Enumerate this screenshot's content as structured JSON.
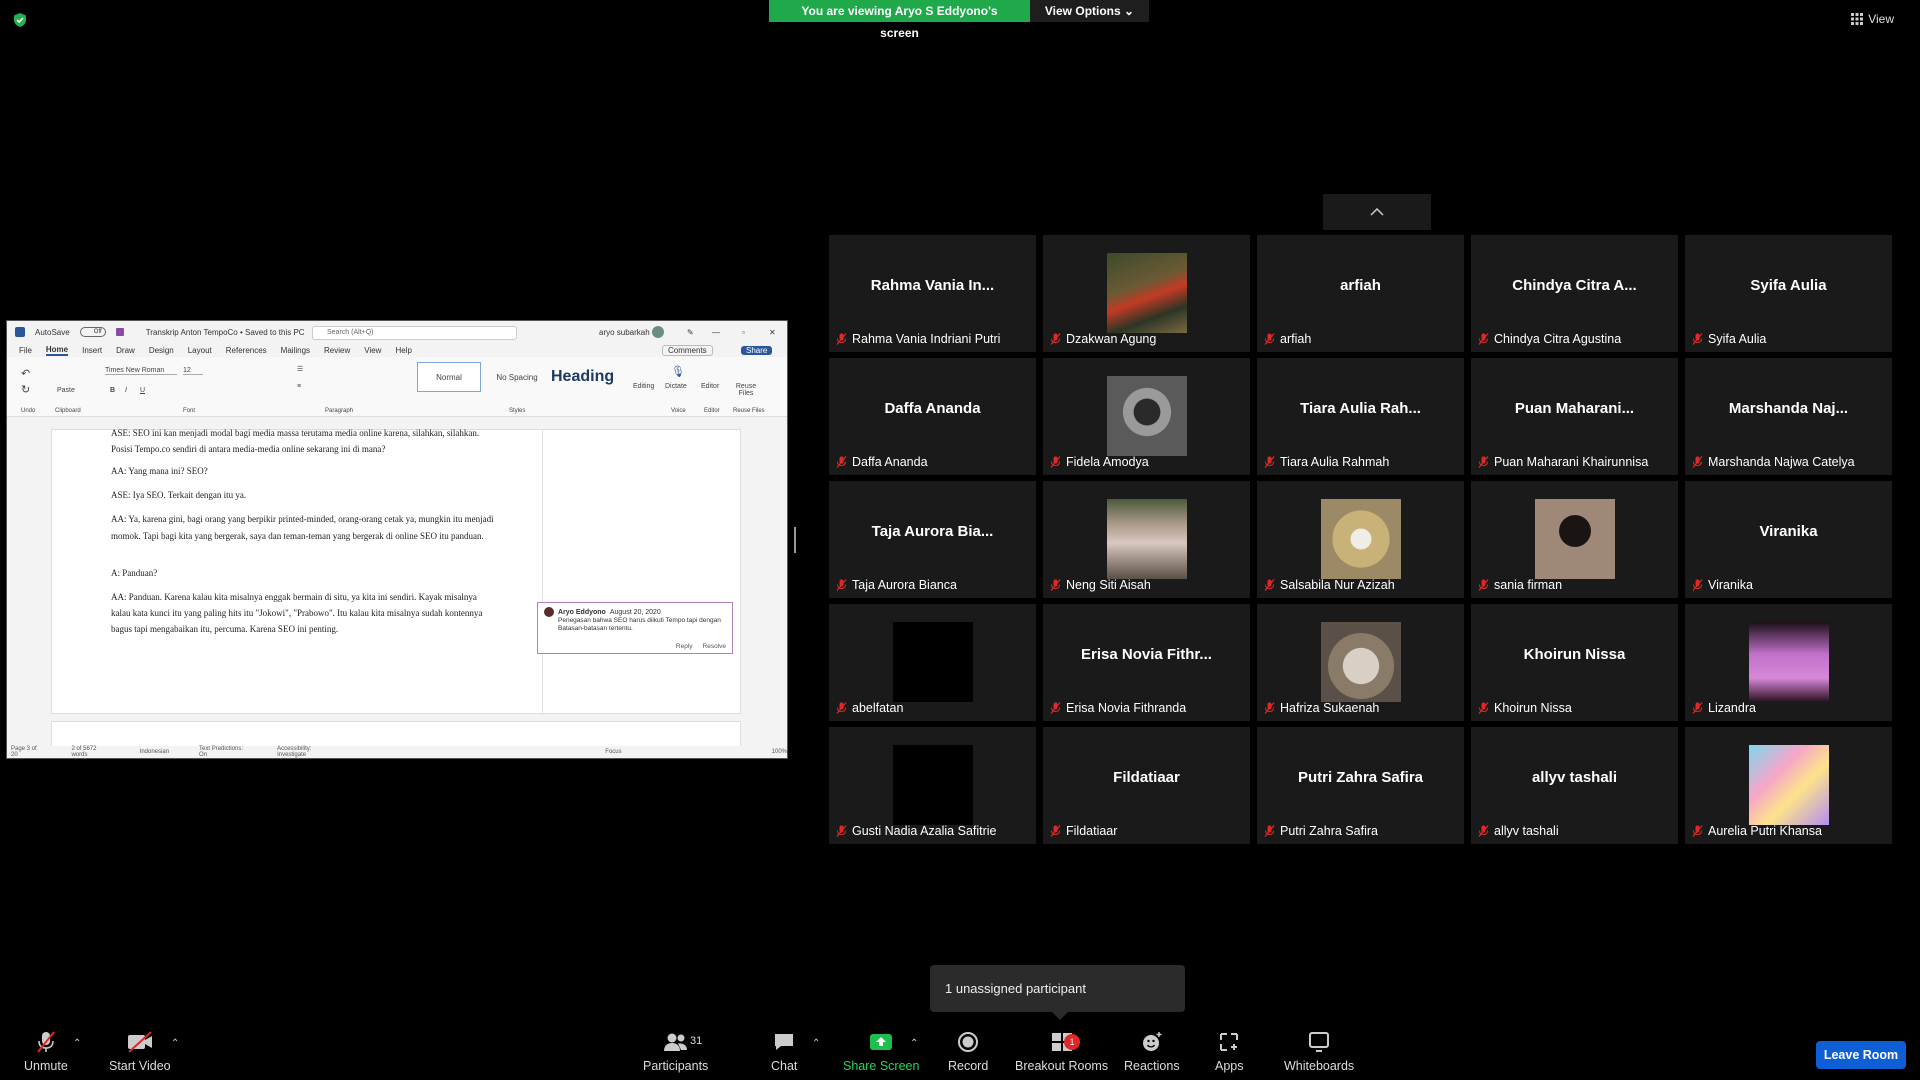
{
  "banner": {
    "viewing": "You are viewing Aryo S Eddyono's screen",
    "view_options": "View Options"
  },
  "view_label": "View",
  "word": {
    "autosave": "AutoSave",
    "autosave_state": "Off",
    "doc_title": "Transkrip Anton TempoCo • Saved to this PC",
    "search": "Search (Alt+Q)",
    "user": "aryo subarkah",
    "menu": [
      "File",
      "Home",
      "Insert",
      "Draw",
      "Design",
      "Layout",
      "References",
      "Mailings",
      "Review",
      "View",
      "Help"
    ],
    "comments": "Comments",
    "share": "Share",
    "font_name": "Times New Roman",
    "font_size": "12",
    "styles": [
      "Normal",
      "No Spacing",
      "Heading"
    ],
    "ribbon_groups": [
      "Undo",
      "Clipboard",
      "Font",
      "Paragraph",
      "Styles",
      "Voice",
      "Editor",
      "Reuse Files"
    ],
    "ribbon_buttons": [
      "Paste",
      "Editing",
      "Dictate",
      "Editor",
      "Reuse Files"
    ],
    "paragraphs": [
      "ASE: SEO ini kan menjadi modal bagi media massa terutama media online karena, silahkan, silahkan. Posisi Tempo.co sendiri di antara media-media online sekarang ini di mana?",
      "AA: Yang mana ini? SEO?",
      "ASE: Iya SEO. Terkait dengan itu ya.",
      "AA: Ya, karena gini, bagi orang yang berpikir printed-minded, orang-orang cetak ya, mungkin itu menjadi momok. Tapi bagi kita yang bergerak, saya dan teman-teman yang bergerak di online SEO itu panduan.",
      "A: Panduan?",
      "AA: Panduan. Karena kalau kita misalnya enggak bermain di situ, ya kita ini sendiri. Kayak misalnya kalau kata kunci itu yang paling hits itu \"Jokowi\", \"Prabowo\". Itu kalau kita misalnya sudah kontennya bagus tapi mengabaikan itu, percuma. Karena SEO ini penting."
    ],
    "comment": {
      "author": "Aryo Eddyono",
      "date": "August 20, 2020",
      "text": "Penegasan bahwa SEO harus diikuti Tempo tapi dengan Batasan-batasan tertentu.",
      "reply": "Reply",
      "resolve": "Resolve"
    },
    "status": [
      "Page 3 of 20",
      "2 of 5672 words",
      "Indonesian",
      "Text Predictions: On",
      "Accessibility: Investigate",
      "Focus",
      "100%"
    ]
  },
  "participants": [
    {
      "big": "Rahma Vania In...",
      "name": "Rahma Vania Indriani Putri",
      "photo": null
    },
    {
      "big": "",
      "name": "Dzakwan Agung",
      "photo": "outdoor"
    },
    {
      "big": "arfiah",
      "name": "arfiah",
      "photo": null
    },
    {
      "big": "Chindya Citra A...",
      "name": "Chindya Citra Agustina",
      "photo": null
    },
    {
      "big": "Syifa Aulia",
      "name": "Syifa Aulia",
      "photo": null
    },
    {
      "big": "Daffa Ananda",
      "name": "Daffa Ananda",
      "photo": null
    },
    {
      "big": "",
      "name": "Fidela Amodya",
      "photo": "bw"
    },
    {
      "big": "Tiara Aulia Rah...",
      "name": "Tiara Aulia Rahmah",
      "photo": null
    },
    {
      "big": "Puan Maharani...",
      "name": "Puan Maharani Khairunnisa",
      "photo": null
    },
    {
      "big": "Marshanda Naj...",
      "name": "Marshanda Najwa Catelya",
      "photo": null
    },
    {
      "big": "Taja Aurora Bia...",
      "name": "Taja Aurora Bianca",
      "photo": null
    },
    {
      "big": "",
      "name": "Neng Siti Aisah",
      "photo": "street"
    },
    {
      "big": "",
      "name": "Salsabila Nur Azizah",
      "photo": "hoodie"
    },
    {
      "big": "",
      "name": "sania firman",
      "photo": "dark"
    },
    {
      "big": "Viranika",
      "name": "Viranika",
      "photo": null
    },
    {
      "big": "",
      "name": "abelfatan",
      "photo": "black"
    },
    {
      "big": "Erisa Novia Fithr...",
      "name": "Erisa Novia Fithranda",
      "photo": null
    },
    {
      "big": "",
      "name": "Hafriza Sukaenah",
      "photo": "cat"
    },
    {
      "big": "Khoirun Nissa",
      "name": "Khoirun Nissa",
      "photo": null
    },
    {
      "big": "",
      "name": "Lizandra",
      "photo": "pink"
    },
    {
      "big": "",
      "name": "Gusti Nadia Azalia Safitrie",
      "photo": "black"
    },
    {
      "big": "Fildatiaar",
      "name": "Fildatiaar",
      "photo": null
    },
    {
      "big": "Putri Zahra Safira",
      "name": "Putri Zahra Safira",
      "photo": null
    },
    {
      "big": "allyv tashali",
      "name": "allyv tashali",
      "photo": null
    },
    {
      "big": "",
      "name": "Aurelia Putri Khansa",
      "photo": "pastel"
    }
  ],
  "popup": "1 unassigned participant",
  "toolbar": {
    "unmute": "Unmute",
    "start_video": "Start Video",
    "participants": "Participants",
    "participant_count": "31",
    "chat": "Chat",
    "share_screen": "Share Screen",
    "record": "Record",
    "breakout": "Breakout Rooms",
    "breakout_badge": "1",
    "reactions": "Reactions",
    "apps": "Apps",
    "whiteboards": "Whiteboards",
    "leave": "Leave Room"
  },
  "colors": {
    "share_green": "#1fa94a",
    "leave_blue": "#0e5ed6",
    "mic_red": "#e02828",
    "tile_bg": "#1a1a1a"
  }
}
